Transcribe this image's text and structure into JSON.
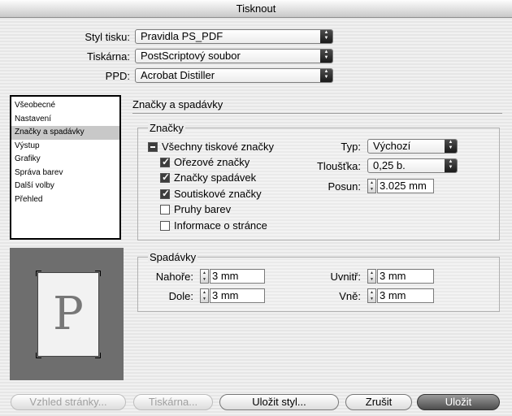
{
  "window": {
    "title": "Tisknout"
  },
  "top_fields": {
    "style": {
      "label": "Styl tisku:",
      "value": "Pravidla PS_PDF"
    },
    "printer": {
      "label": "Tiskárna:",
      "value": "PostScriptový soubor"
    },
    "ppd": {
      "label": "PPD:",
      "value": "Acrobat Distiller"
    }
  },
  "sidebar": {
    "items": [
      {
        "label": "Všeobecné",
        "selected": false
      },
      {
        "label": "Nastavení",
        "selected": false
      },
      {
        "label": "Značky a spadávky",
        "selected": true
      },
      {
        "label": "Výstup",
        "selected": false
      },
      {
        "label": "Grafiky",
        "selected": false
      },
      {
        "label": "Správa barev",
        "selected": false
      },
      {
        "label": "Další volby",
        "selected": false
      },
      {
        "label": "Přehled",
        "selected": false
      }
    ]
  },
  "preview": {
    "letter": "P"
  },
  "main": {
    "section_title": "Značky a spadávky",
    "marks": {
      "title": "Značky",
      "all_marks": {
        "label": "Všechny tiskové značky",
        "state": "mixed"
      },
      "crop_marks": {
        "label": "Ořezové značky",
        "checked": true
      },
      "bleed_marks": {
        "label": "Značky spadávek",
        "checked": true
      },
      "registration_marks": {
        "label": "Soutiskové značky",
        "checked": true
      },
      "color_bars": {
        "label": "Pruhy barev",
        "checked": false
      },
      "page_info": {
        "label": "Informace o stránce",
        "checked": false
      },
      "type": {
        "label": "Typ:",
        "value": "Výchozí"
      },
      "weight": {
        "label": "Tloušťka:",
        "value": "0,25 b."
      },
      "offset": {
        "label": "Posun:",
        "value": "3.025 mm"
      }
    },
    "bleed": {
      "title": "Spadávky",
      "top": {
        "label": "Nahoře:",
        "value": "3 mm"
      },
      "bottom": {
        "label": "Dole:",
        "value": "3 mm"
      },
      "inside": {
        "label": "Uvnitř:",
        "value": "3 mm"
      },
      "outside": {
        "label": "Vně:",
        "value": "3 mm"
      }
    }
  },
  "buttons": {
    "page_setup": "Vzhled stránky...",
    "printer": "Tiskárna...",
    "save_style": "Uložit styl...",
    "cancel": "Zrušit",
    "save": "Uložit"
  }
}
